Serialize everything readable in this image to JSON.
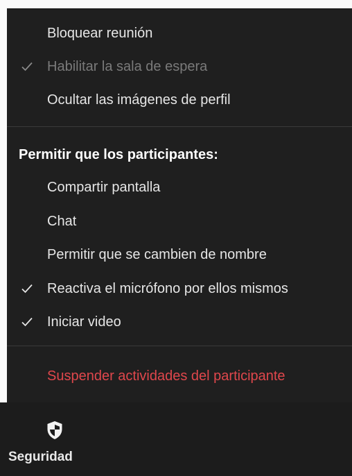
{
  "menu": {
    "items_top": [
      {
        "label": "Bloquear reunión",
        "checked": false,
        "disabled": false
      },
      {
        "label": "Habilitar la sala de espera",
        "checked": true,
        "disabled": true
      },
      {
        "label": "Ocultar las imágenes de perfil",
        "checked": false,
        "disabled": false
      }
    ],
    "section_title": "Permitir que los participantes:",
    "items_permissions": [
      {
        "label": "Compartir pantalla",
        "checked": false
      },
      {
        "label": "Chat",
        "checked": false
      },
      {
        "label": "Permitir que se cambien de nombre",
        "checked": false
      },
      {
        "label": "Reactiva el micrófono por ellos mismos",
        "checked": true
      },
      {
        "label": "Iniciar video",
        "checked": true
      }
    ],
    "danger_item": {
      "label": "Suspender actividades del participante"
    }
  },
  "toolbar": {
    "security": {
      "label": "Seguridad",
      "icon": "shield-icon"
    }
  },
  "colors": {
    "menu_bg": "#1f1f1f",
    "text": "#e6e6e6",
    "disabled_text": "#7a7a7a",
    "danger": "#e0474c",
    "divider": "#3a3a3a"
  }
}
